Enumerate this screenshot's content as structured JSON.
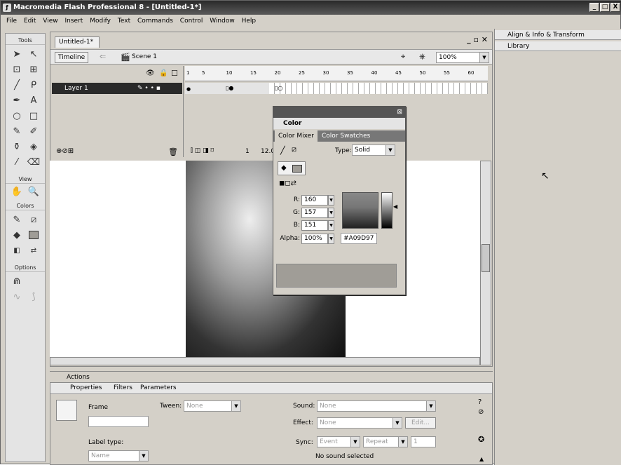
{
  "window": {
    "title": "Macromedia Flash Professional 8 - [Untitled-1*]",
    "controls": [
      "_",
      "□",
      "X"
    ]
  },
  "menu": [
    "File",
    "Edit",
    "View",
    "Insert",
    "Modify",
    "Text",
    "Commands",
    "Control",
    "Window",
    "Help"
  ],
  "tools": {
    "title": "Tools",
    "view_label": "View",
    "colors_label": "Colors",
    "options_label": "Options"
  },
  "document": {
    "tab": "Untitled-1*",
    "timeline_button": "Timeline",
    "scene": "Scene 1",
    "zoom": "100%",
    "layer": "Layer 1",
    "frame_ticks": [
      "1",
      "5",
      "10",
      "15",
      "20",
      "25",
      "30",
      "35",
      "40",
      "45",
      "50",
      "55",
      "60"
    ],
    "current_frame": "1",
    "fps": "12.0"
  },
  "color_panel": {
    "title": "Color",
    "tabs": [
      "Color Mixer",
      "Color Swatches"
    ],
    "type_label": "Type:",
    "type_value": "Solid",
    "r_label": "R:",
    "r": "160",
    "g_label": "G:",
    "g": "157",
    "b_label": "B:",
    "b": "151",
    "alpha_label": "Alpha:",
    "alpha": "100%",
    "hex": "#A09D97",
    "swatch_color": "#A09D97"
  },
  "panels": {
    "align": "Align & Info & Transform",
    "library": "Library",
    "actions": "Actions"
  },
  "properties": {
    "tabs": [
      "Properties",
      "Filters",
      "Parameters"
    ],
    "frame_label": "Frame",
    "tween_label": "Tween:",
    "tween_value": "None",
    "sound_label": "Sound:",
    "sound_value": "None",
    "effect_label": "Effect:",
    "effect_value": "None",
    "edit_button": "Edit...",
    "sync_label": "Sync:",
    "sync_value": "Event",
    "repeat_value": "Repeat",
    "repeat_count": "1",
    "label_type_label": "Label type:",
    "label_type_value": "Name",
    "no_sound": "No sound selected"
  }
}
